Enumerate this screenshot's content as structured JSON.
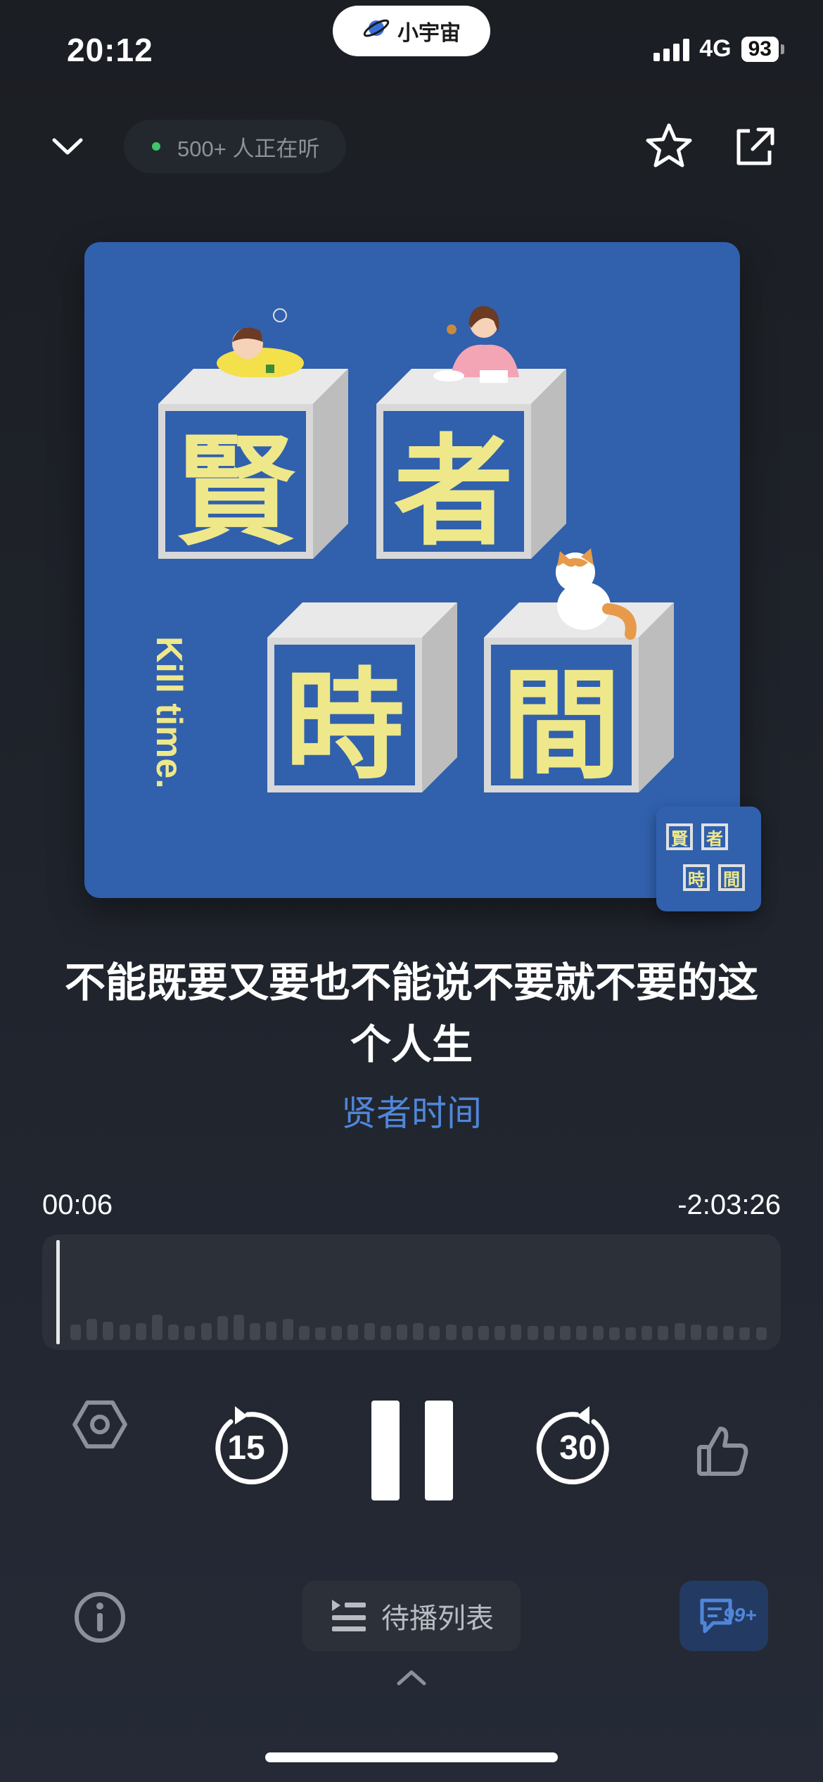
{
  "status_bar": {
    "time": "20:12",
    "island_label": "小宇宙",
    "network": "4G",
    "battery": "93"
  },
  "header": {
    "listeners_text": "500+ 人正在听",
    "icons": [
      "chevron-down-icon",
      "star-icon",
      "share-icon"
    ]
  },
  "cover": {
    "chars": [
      "賢",
      "者",
      "時",
      "間"
    ],
    "side_text": "Kill time.",
    "accent_color": "#efe88a",
    "background_color": "#3160ad"
  },
  "episode": {
    "title": "不能既要又要也不能说不要就不要的这个人生",
    "podcast": "贤者时间"
  },
  "progress": {
    "current": "00:06",
    "remaining": "-2:03:26"
  },
  "controls": {
    "rewind_seconds": "15",
    "forward_seconds": "30"
  },
  "bottom": {
    "queue_label": "待播列表",
    "comment_count": "99+"
  }
}
